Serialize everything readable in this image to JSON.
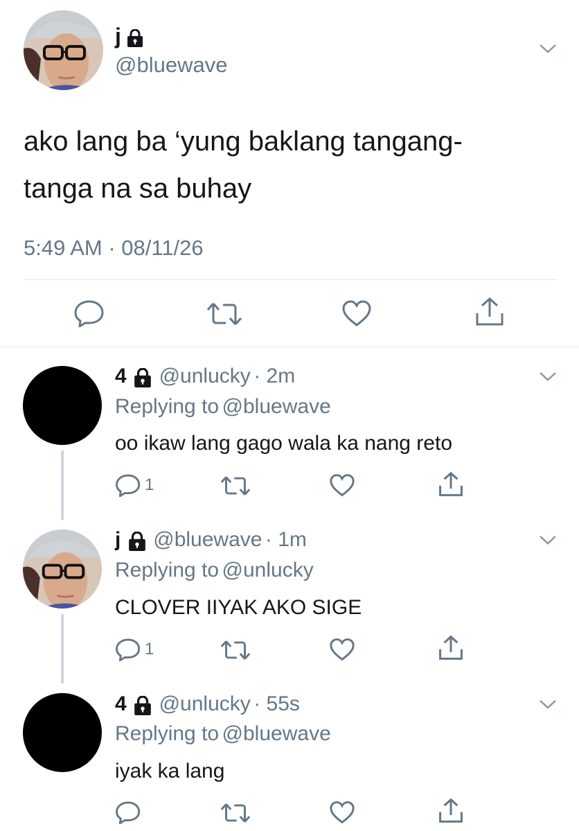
{
  "main_tweet": {
    "display_name": "j",
    "handle": "@bluewave",
    "text_line1": "ako lang ba ‘yung baklang tangang-",
    "text_line2": "tanga na sa buhay",
    "timestamp": "5:49 AM · 08/11/26"
  },
  "replies": [
    {
      "display_name": "4",
      "handle": "@unlucky",
      "time": "· 2m",
      "replying_prefix": "Replying to",
      "replying_to": "@bluewave",
      "text": "oo ikaw lang gago wala ka nang reto",
      "reply_count": "1"
    },
    {
      "display_name": "j",
      "handle": "@bluewave",
      "time": "· 1m",
      "replying_prefix": "Replying to",
      "replying_to": "@unlucky",
      "text": "CLOVER IIYAK AKO SIGE",
      "reply_count": "1"
    },
    {
      "display_name": "4",
      "handle": "@unlucky",
      "time": "· 55s",
      "replying_prefix": "Replying to",
      "replying_to": "@bluewave",
      "text": "iyak ka lang",
      "reply_count": ""
    }
  ],
  "colors": {
    "text": "#14171a",
    "secondary": "#657786",
    "link": "#1b95e0",
    "divider": "#e1e8ed"
  },
  "icons": [
    "lock-icon",
    "chevron-down-icon",
    "reply-icon",
    "retweet-icon",
    "like-icon",
    "share-icon"
  ]
}
